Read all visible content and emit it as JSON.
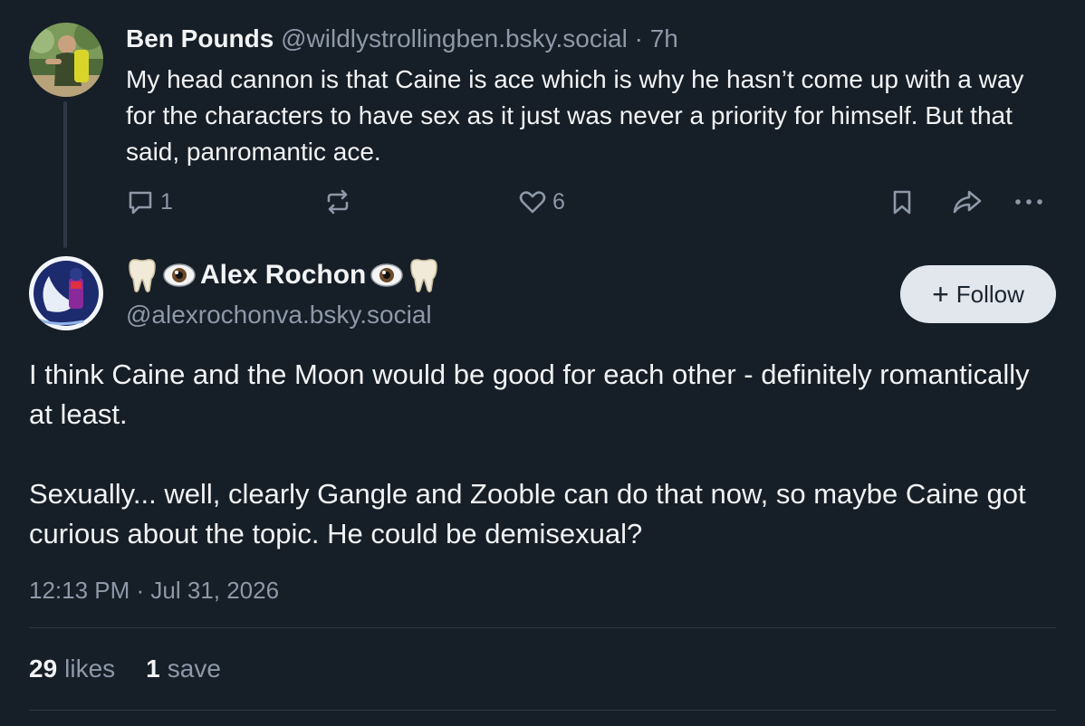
{
  "reply": {
    "author_name": "Ben Pounds",
    "author_handle": "@wildlystrollingben.bsky.social",
    "separator": "·",
    "time": "7h",
    "text": "My head cannon is that Caine is ace which is why he hasn’t come up with a way for the characters to have sex as it just was never a priority for himself. But that said, panromantic ace.",
    "reply_count": "1",
    "like_count": "6",
    "avatar_icon": "person-photo-avatar"
  },
  "post": {
    "author_name": "Alex Rochon",
    "author_handle": "@alexrochonva.bsky.social",
    "name_emojis": [
      "tooth",
      "eye",
      "eye",
      "tooth"
    ],
    "follow_label": "Follow",
    "paragraph_1": "I think Caine and the Moon would be good for each other - definitely romantically at least.",
    "paragraph_2": "Sexually... well, clearly Gangle and Zooble can do that now, so maybe Caine got curious about the topic. He could be demisexual?",
    "date": "12:13 PM · Jul 31, 2026",
    "avatar_icon": "moon-character-avatar"
  },
  "stats": {
    "likes_count": "29",
    "likes_label": "likes",
    "saves_count": "1",
    "saves_label": "save"
  },
  "colors": {
    "background": "#161e27",
    "text": "#f1f3f5",
    "muted": "#8d99a8",
    "divider": "#2e3844",
    "follow_bg": "#e2e7ee"
  }
}
